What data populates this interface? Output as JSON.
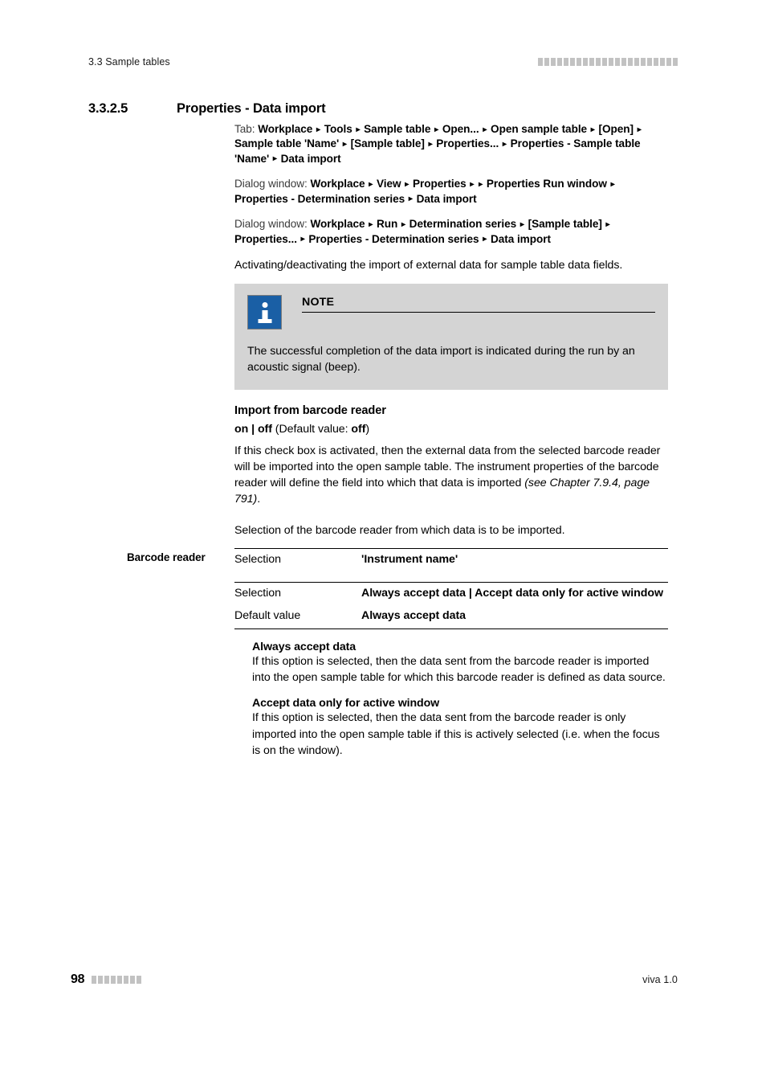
{
  "header": {
    "running_title": "3.3 Sample tables",
    "decoration_squares": 22,
    "decoration_color": "#c2c2c2"
  },
  "section": {
    "number": "3.3.2.5",
    "title": "Properties - Data import"
  },
  "paths": [
    {
      "lead": "Tab:",
      "text": "Workplace ▸ Tools ▸ Sample table ▸ Open... ▸ Open sample table ▸ [Open] ▸ Sample table 'Name' ▸ [Sample table] ▸ Properties... ▸ Properties - Sample table 'Name' ▸ Data import"
    },
    {
      "lead": "Dialog window:",
      "text": "Workplace ▸ View ▸ Properties ▸  ▸ Properties Run window ▸ Properties - Determination series ▸ Data import"
    },
    {
      "lead": "Dialog window:",
      "text": "Workplace ▸ Run ▸ Determination series ▸ [Sample table] ▸ Properties... ▸ Properties - Determination series ▸ Data import"
    }
  ],
  "intro": "Activating/deactivating the import of external data for sample table data fields.",
  "note": {
    "title": "NOTE",
    "icon": "info-icon",
    "icon_color": "#1a5fa5",
    "background": "#d4d4d4",
    "body": "The successful completion of the data import is indicated during the run by an acoustic signal (beep)."
  },
  "import_section": {
    "heading": "Import from barcode reader",
    "values_bold_1": "on",
    "values_sep": " | ",
    "values_bold_2": "off",
    "default_prefix": " (Default value: ",
    "default_bold": "off",
    "default_suffix": ")",
    "description_part1": "If this check box is activated, then the external data from the selected barcode reader will be imported into the open sample table. The instrument properties of the barcode reader will define the field into which that data is imported ",
    "description_ref": "(see Chapter 7.9.4, page 791)",
    "description_part2": "."
  },
  "barcode_section": {
    "margin_label": "Barcode reader",
    "description": "Selection of the barcode reader from which data is to be imported.",
    "table": [
      {
        "key": "Selection",
        "value": "'Instrument name'",
        "group": 1
      },
      {
        "key": "Selection",
        "value": "Always accept data | Accept data only for active window",
        "group": 2
      },
      {
        "key": "Default value",
        "value": "Always accept data",
        "group": 2
      }
    ],
    "options": [
      {
        "name": "Always accept data",
        "text": "If this option is selected, then the data sent from the barcode reader is imported into the open sample table for which this barcode reader is defined as data source."
      },
      {
        "name": "Accept data only for active window",
        "text": "If this option is selected, then the data sent from the barcode reader is only imported into the open sample table if this is actively selected (i.e. when the focus is on the window)."
      }
    ]
  },
  "footer": {
    "page_number": "98",
    "decoration_squares": 8,
    "product": "viva 1.0"
  }
}
